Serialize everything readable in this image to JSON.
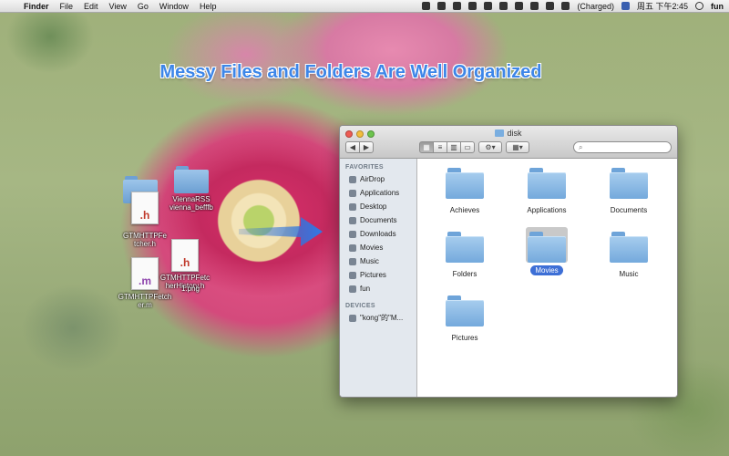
{
  "menubar": {
    "app": "Finder",
    "items": [
      "File",
      "Edit",
      "View",
      "Go",
      "Window",
      "Help"
    ],
    "battery": "(Charged)",
    "clock": "周五 下午2:45",
    "user": "fun"
  },
  "headline": "Messy Files and Folders Are Well Organized",
  "desktop": {
    "files": [
      {
        "label": "ViennaRSS\nvienna_befffb",
        "type": "folder"
      },
      {
        "label": "GTMHTTPFetcher.h",
        "type": "doc",
        "ext": ".h"
      },
      {
        "label": "GTMHTTPFetcher.m",
        "type": "doc",
        "ext": ".m"
      },
      {
        "label": "GTMHTTPFetcherHistory.h",
        "type": "doc",
        "ext": ".h"
      },
      {
        "label": "1.png",
        "type": "doc",
        "ext": ""
      }
    ]
  },
  "finder": {
    "title": "disk",
    "search_placeholder": "",
    "sidebar": {
      "favorites_header": "FAVORITES",
      "favorites": [
        "AirDrop",
        "Applications",
        "Desktop",
        "Documents",
        "Downloads",
        "Movies",
        "Music",
        "Pictures",
        "fun"
      ],
      "devices_header": "DEVICES",
      "devices": [
        "\"kong\"的\"M..."
      ]
    },
    "items": [
      {
        "label": "Achieves"
      },
      {
        "label": "Applications"
      },
      {
        "label": "Documents"
      },
      {
        "label": "Folders"
      },
      {
        "label": "Movies",
        "selected": true
      },
      {
        "label": "Music"
      },
      {
        "label": "Pictures"
      }
    ]
  }
}
